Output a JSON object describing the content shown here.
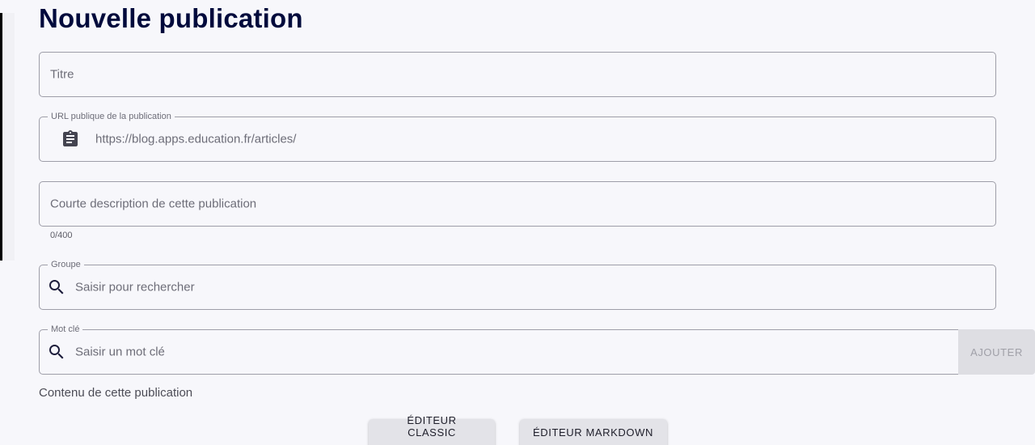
{
  "page": {
    "title": "Nouvelle publication"
  },
  "form": {
    "title_field": {
      "placeholder": "Titre"
    },
    "url_field": {
      "label": "URL publique de la publication",
      "value": "https://blog.apps.education.fr/articles/",
      "icon": "clipboard-icon"
    },
    "description_field": {
      "placeholder": "Courte description de cette publication",
      "counter": "0/400"
    },
    "group_field": {
      "label": "Groupe",
      "placeholder": "Saisir pour rechercher",
      "icon": "search-icon"
    },
    "keyword_field": {
      "label": "Mot clé",
      "placeholder": "Saisir un mot clé",
      "icon": "search-icon",
      "add_label": "AJOUTER"
    },
    "content": {
      "label": "Contenu de cette publication",
      "editor_classic_label": "ÉDITEUR CLASSIC",
      "editor_markdown_label": "ÉDITEUR MARKDOWN"
    }
  },
  "colors": {
    "title": "#000a3c",
    "border": "#9e9ea8",
    "background": "#f7f7fb"
  }
}
